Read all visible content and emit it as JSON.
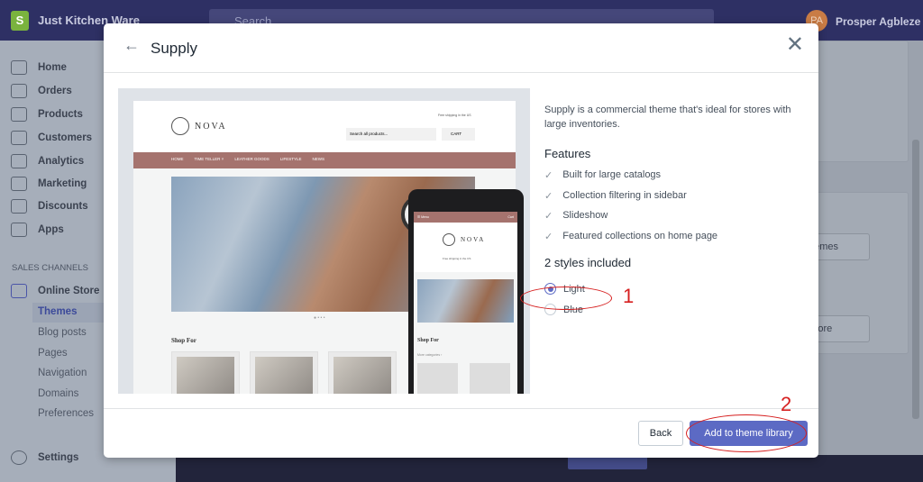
{
  "topbar": {
    "store_name": "Just Kitchen Ware",
    "search_placeholder": "Search",
    "user_initials": "PA",
    "user_name": "Prosper Agbleze"
  },
  "sidebar": {
    "items": [
      {
        "label": "Home",
        "icon": "home-icon"
      },
      {
        "label": "Orders",
        "icon": "orders-icon"
      },
      {
        "label": "Products",
        "icon": "tag-icon"
      },
      {
        "label": "Customers",
        "icon": "person-icon"
      },
      {
        "label": "Analytics",
        "icon": "chart-icon"
      },
      {
        "label": "Marketing",
        "icon": "megaphone-icon"
      },
      {
        "label": "Discounts",
        "icon": "discount-icon"
      },
      {
        "label": "Apps",
        "icon": "apps-icon"
      }
    ],
    "section_label": "SALES CHANNELS",
    "channel": "Online Store",
    "subitems": [
      "Themes",
      "Blog posts",
      "Pages",
      "Navigation",
      "Domains",
      "Preferences"
    ],
    "active_subitem": "Themes",
    "settings": "Settings"
  },
  "background": {
    "themes_button": "hemes",
    "store_button": "Store"
  },
  "modal": {
    "title": "Supply",
    "description": "Supply is a commercial theme that's ideal for stores with large inventories.",
    "features_heading": "Features",
    "features": [
      "Built for large catalogs",
      "Collection filtering in sidebar",
      "Slideshow",
      "Featured collections on home page"
    ],
    "styles_heading": "2 styles included",
    "styles": [
      {
        "label": "Light",
        "selected": true
      },
      {
        "label": "Blue",
        "selected": false
      }
    ],
    "back_label": "Back",
    "add_label": "Add to theme library",
    "preview": {
      "brand": "NOVA",
      "shipping": "Free shipping in the US",
      "search": "Search all products...",
      "cart": "CART",
      "nav": [
        "HOME",
        "TIME TELLER ˅",
        "LEATHER GOODS",
        "LIFESTYLE",
        "NEWS"
      ],
      "shop_for": "Shop For",
      "mobile_menu": "☰ Menu",
      "mobile_cart": "Cart",
      "mobile_categories": "More categories ›"
    }
  },
  "annotations": {
    "one": "1",
    "two": "2",
    "color": "#d61f1f"
  },
  "colors": {
    "accent": "#5c6ac4",
    "topbar": "#2e3064"
  }
}
